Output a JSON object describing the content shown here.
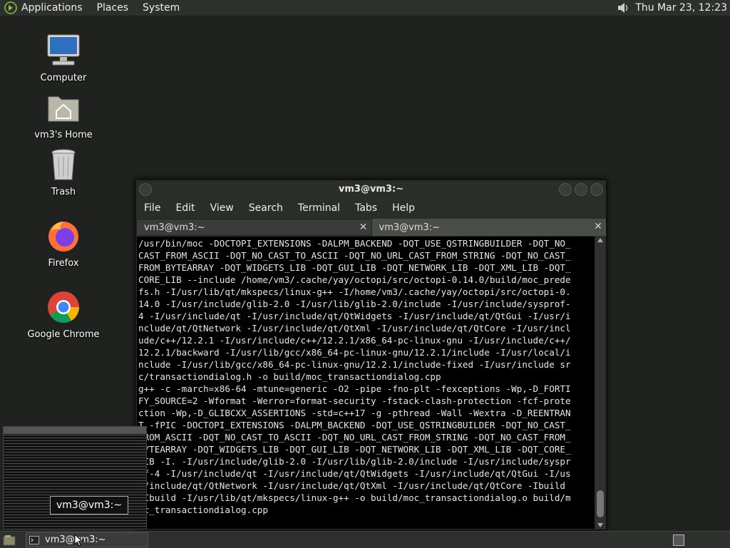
{
  "top_panel": {
    "menus": [
      "Applications",
      "Places",
      "System"
    ],
    "clock": "Thu Mar 23, 12:23"
  },
  "desktop": {
    "icons": [
      {
        "label": "Computer",
        "icon": "computer-icon"
      },
      {
        "label": "vm3's Home",
        "icon": "home-folder-icon"
      },
      {
        "label": "Trash",
        "icon": "trash-icon"
      },
      {
        "label": "Firefox",
        "icon": "firefox-icon"
      },
      {
        "label": "Google Chrome",
        "icon": "chrome-icon"
      }
    ]
  },
  "terminal": {
    "title": "vm3@vm3:~",
    "menus": [
      "File",
      "Edit",
      "View",
      "Search",
      "Terminal",
      "Tabs",
      "Help"
    ],
    "tabs": [
      {
        "label": "vm3@vm3:~",
        "active": true
      },
      {
        "label": "vm3@vm3:~",
        "active": false
      }
    ],
    "output": "/usr/bin/moc -DOCTOPI_EXTENSIONS -DALPM_BACKEND -DQT_USE_QSTRINGBUILDER -DQT_NO_\nCAST_FROM_ASCII -DQT_NO_CAST_TO_ASCII -DQT_NO_URL_CAST_FROM_STRING -DQT_NO_CAST_\nFROM_BYTEARRAY -DQT_WIDGETS_LIB -DQT_GUI_LIB -DQT_NETWORK_LIB -DQT_XML_LIB -DQT_\nCORE_LIB --include /home/vm3/.cache/yay/octopi/src/octopi-0.14.0/build/moc_prede\nfs.h -I/usr/lib/qt/mkspecs/linux-g++ -I/home/vm3/.cache/yay/octopi/src/octopi-0.\n14.0 -I/usr/include/glib-2.0 -I/usr/lib/glib-2.0/include -I/usr/include/sysprof-\n4 -I/usr/include/qt -I/usr/include/qt/QtWidgets -I/usr/include/qt/QtGui -I/usr/i\nnclude/qt/QtNetwork -I/usr/include/qt/QtXml -I/usr/include/qt/QtCore -I/usr/incl\nude/c++/12.2.1 -I/usr/include/c++/12.2.1/x86_64-pc-linux-gnu -I/usr/include/c++/\n12.2.1/backward -I/usr/lib/gcc/x86_64-pc-linux-gnu/12.2.1/include -I/usr/local/i\nnclude -I/usr/lib/gcc/x86_64-pc-linux-gnu/12.2.1/include-fixed -I/usr/include sr\nc/transactiondialog.h -o build/moc_transactiondialog.cpp\ng++ -c -march=x86-64 -mtune=generic -O2 -pipe -fno-plt -fexceptions -Wp,-D_FORTI\nFY_SOURCE=2 -Wformat -Werror=format-security -fstack-clash-protection -fcf-prote\nction -Wp,-D_GLIBCXX_ASSERTIONS -std=c++17 -g -pthread -Wall -Wextra -D_REENTRAN\nT -fPIC -DOCTOPI_EXTENSIONS -DALPM_BACKEND -DQT_USE_QSTRINGBUILDER -DQT_NO_CAST_\nFROM_ASCII -DQT_NO_CAST_TO_ASCII -DQT_NO_URL_CAST_FROM_STRING -DQT_NO_CAST_FROM_\nBYTEARRAY -DQT_WIDGETS_LIB -DQT_GUI_LIB -DQT_NETWORK_LIB -DQT_XML_LIB -DQT_CORE_\nLIB -I. -I/usr/include/glib-2.0 -I/usr/lib/glib-2.0/include -I/usr/include/syspr\nof-4 -I/usr/include/qt -I/usr/include/qt/QtWidgets -I/usr/include/qt/QtGui -I/us\nr/include/qt/QtNetwork -I/usr/include/qt/QtXml -I/usr/include/qt/QtCore -Ibuild \n-Ibuild -I/usr/lib/qt/mkspecs/linux-g++ -o build/moc_transactiondialog.o build/m\noc_transactiondialog.cpp"
  },
  "preview": {
    "label": "vm3@vm3:~"
  },
  "bottom_panel": {
    "task_label": "vm3@vm3:~"
  }
}
